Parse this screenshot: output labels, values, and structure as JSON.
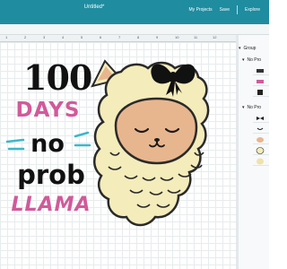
{
  "app": {
    "title": "Untitled*",
    "my_projects": "My Projects",
    "save": "Save",
    "explore": "Explore"
  },
  "ruler": {
    "ticks": [
      "1",
      "2",
      "3",
      "4",
      "5",
      "6",
      "7",
      "8",
      "9",
      "10",
      "11",
      "12"
    ]
  },
  "design": {
    "line1": "100",
    "line2": "DAYS",
    "line3": "no",
    "line4": "prob",
    "line5": "LLAMA"
  },
  "layers": {
    "group_label": "Group",
    "items": [
      {
        "label": "No Pro"
      },
      {
        "label": "No Pro"
      }
    ]
  },
  "colors": {
    "topbar": "#1f8ca0",
    "pink": "#d15a9a",
    "wool": "#f4ecbb",
    "face": "#e8b68e",
    "bow": "#111111",
    "cyan_lines": "#3bb7c8"
  }
}
